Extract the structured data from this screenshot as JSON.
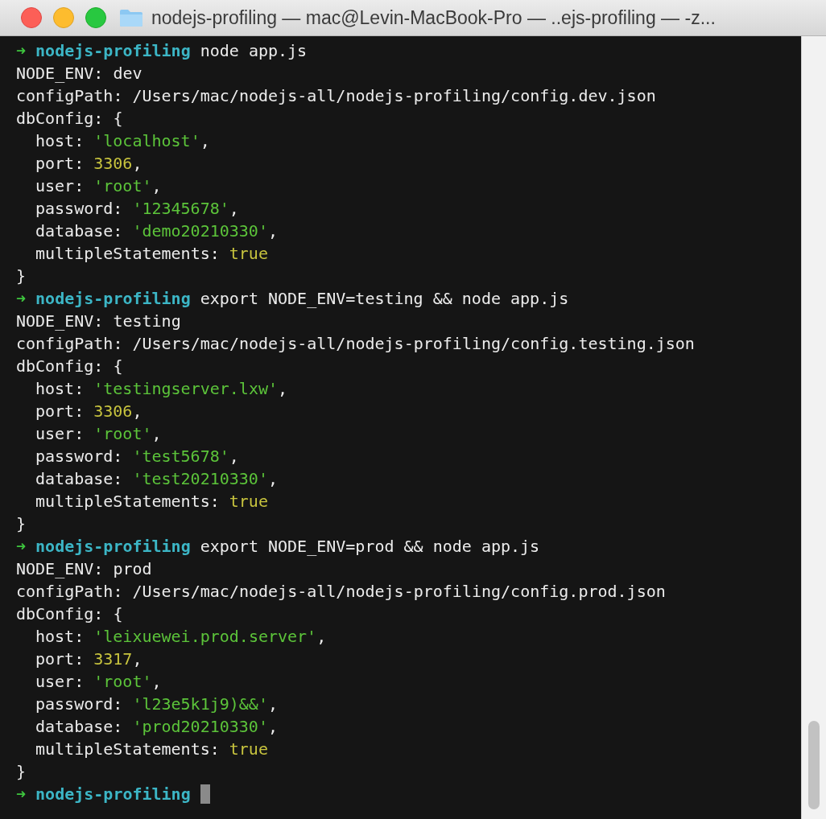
{
  "window": {
    "title": "nodejs-profiling — mac@Levin-MacBook-Pro — ..ejs-profiling — -z..."
  },
  "lines": [
    {
      "segments": [
        {
          "kind": "arrow",
          "t": "➜"
        },
        {
          "kind": "dir",
          "t": "nodejs-profiling"
        },
        {
          "kind": "cmd",
          "t": "node app.js"
        }
      ]
    },
    {
      "segments": [
        {
          "kind": "text",
          "t": "NODE_ENV: dev"
        }
      ]
    },
    {
      "segments": [
        {
          "kind": "text",
          "t": "configPath: /Users/mac/nodejs-all/nodejs-profiling/config.dev.json"
        }
      ]
    },
    {
      "segments": [
        {
          "kind": "text",
          "t": "dbConfig: {"
        }
      ],
      "children": [
        {
          "segments": [
            {
              "kind": "key",
              "t": "host:"
            },
            {
              "kind": "string",
              "t": "'localhost'"
            },
            {
              "kind": "punct",
              "t": ","
            }
          ]
        },
        {
          "segments": [
            {
              "kind": "key",
              "t": "port:"
            },
            {
              "kind": "number",
              "t": "3306"
            },
            {
              "kind": "punct",
              "t": ","
            }
          ]
        },
        {
          "segments": [
            {
              "kind": "key",
              "t": "user:"
            },
            {
              "kind": "string",
              "t": "'root'"
            },
            {
              "kind": "punct",
              "t": ","
            }
          ]
        },
        {
          "segments": [
            {
              "kind": "key",
              "t": "password:"
            },
            {
              "kind": "string",
              "t": "'12345678'"
            },
            {
              "kind": "punct",
              "t": ","
            }
          ]
        },
        {
          "segments": [
            {
              "kind": "key",
              "t": "database:"
            },
            {
              "kind": "string",
              "t": "'demo20210330'"
            },
            {
              "kind": "punct",
              "t": ","
            }
          ]
        },
        {
          "segments": [
            {
              "kind": "key",
              "t": "multipleStatements:"
            },
            {
              "kind": "bool",
              "t": "true"
            }
          ]
        }
      ]
    },
    {
      "segments": [
        {
          "kind": "text",
          "t": "}"
        }
      ]
    },
    {
      "segments": [
        {
          "kind": "arrow",
          "t": "➜"
        },
        {
          "kind": "dir",
          "t": "nodejs-profiling"
        },
        {
          "kind": "cmd",
          "t": "export NODE_ENV=testing && node app.js"
        }
      ]
    },
    {
      "segments": [
        {
          "kind": "text",
          "t": "NODE_ENV: testing"
        }
      ]
    },
    {
      "segments": [
        {
          "kind": "text",
          "t": "configPath: /Users/mac/nodejs-all/nodejs-profiling/config.testing.json"
        }
      ]
    },
    {
      "segments": [
        {
          "kind": "text",
          "t": "dbConfig: {"
        }
      ],
      "children": [
        {
          "segments": [
            {
              "kind": "key",
              "t": "host:"
            },
            {
              "kind": "string",
              "t": "'testingserver.lxw'"
            },
            {
              "kind": "punct",
              "t": ","
            }
          ]
        },
        {
          "segments": [
            {
              "kind": "key",
              "t": "port:"
            },
            {
              "kind": "number",
              "t": "3306"
            },
            {
              "kind": "punct",
              "t": ","
            }
          ]
        },
        {
          "segments": [
            {
              "kind": "key",
              "t": "user:"
            },
            {
              "kind": "string",
              "t": "'root'"
            },
            {
              "kind": "punct",
              "t": ","
            }
          ]
        },
        {
          "segments": [
            {
              "kind": "key",
              "t": "password:"
            },
            {
              "kind": "string",
              "t": "'test5678'"
            },
            {
              "kind": "punct",
              "t": ","
            }
          ]
        },
        {
          "segments": [
            {
              "kind": "key",
              "t": "database:"
            },
            {
              "kind": "string",
              "t": "'test20210330'"
            },
            {
              "kind": "punct",
              "t": ","
            }
          ]
        },
        {
          "segments": [
            {
              "kind": "key",
              "t": "multipleStatements:"
            },
            {
              "kind": "bool",
              "t": "true"
            }
          ]
        }
      ]
    },
    {
      "segments": [
        {
          "kind": "text",
          "t": "}"
        }
      ]
    },
    {
      "segments": [
        {
          "kind": "arrow",
          "t": "➜"
        },
        {
          "kind": "dir",
          "t": "nodejs-profiling"
        },
        {
          "kind": "cmd",
          "t": "export NODE_ENV=prod && node app.js"
        }
      ]
    },
    {
      "segments": [
        {
          "kind": "text",
          "t": "NODE_ENV: prod"
        }
      ]
    },
    {
      "segments": [
        {
          "kind": "text",
          "t": "configPath: /Users/mac/nodejs-all/nodejs-profiling/config.prod.json"
        }
      ]
    },
    {
      "segments": [
        {
          "kind": "text",
          "t": "dbConfig: {"
        }
      ],
      "children": [
        {
          "segments": [
            {
              "kind": "key",
              "t": "host:"
            },
            {
              "kind": "string",
              "t": "'leixuewei.prod.server'"
            },
            {
              "kind": "punct",
              "t": ","
            }
          ]
        },
        {
          "segments": [
            {
              "kind": "key",
              "t": "port:"
            },
            {
              "kind": "number",
              "t": "3317"
            },
            {
              "kind": "punct",
              "t": ","
            }
          ]
        },
        {
          "segments": [
            {
              "kind": "key",
              "t": "user:"
            },
            {
              "kind": "string",
              "t": "'root'"
            },
            {
              "kind": "punct",
              "t": ","
            }
          ]
        },
        {
          "segments": [
            {
              "kind": "key",
              "t": "password:"
            },
            {
              "kind": "string",
              "t": "'l23e5k1j9)&&'"
            },
            {
              "kind": "punct",
              "t": ","
            }
          ]
        },
        {
          "segments": [
            {
              "kind": "key",
              "t": "database:"
            },
            {
              "kind": "string",
              "t": "'prod20210330'"
            },
            {
              "kind": "punct",
              "t": ","
            }
          ]
        },
        {
          "segments": [
            {
              "kind": "key",
              "t": "multipleStatements:"
            },
            {
              "kind": "bool",
              "t": "true"
            }
          ]
        }
      ]
    },
    {
      "segments": [
        {
          "kind": "text",
          "t": "}"
        }
      ]
    },
    {
      "cursor": true,
      "segments": [
        {
          "kind": "arrow",
          "t": "➜"
        },
        {
          "kind": "dir",
          "t": "nodejs-profiling"
        }
      ]
    }
  ]
}
